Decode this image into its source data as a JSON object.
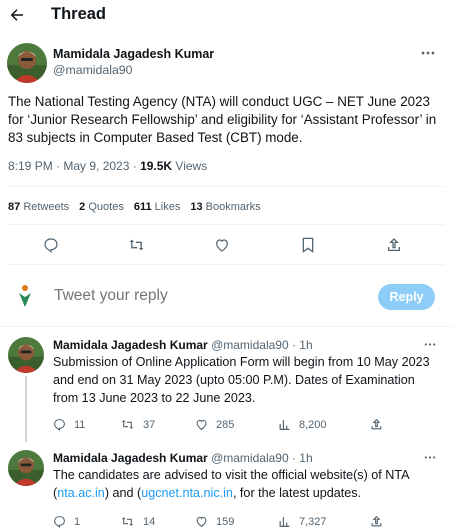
{
  "header": {
    "title": "Thread"
  },
  "main_tweet": {
    "author": "Mamidala Jagadesh Kumar",
    "handle": "@mamidala90",
    "text": "The National Testing Agency (NTA) will conduct UGC – NET June 2023 for ‘Junior Research Fellowship’ and eligibility for ‘Assistant Professor’ in 83 subjects in Computer Based Test (CBT) mode.",
    "time": "8:19 PM · May 9, 2023 · ",
    "views_count": "19.5K",
    "views_label": " Views",
    "retweets_count": "87",
    "retweets_label": "Retweets",
    "quotes_count": "2",
    "quotes_label": "Quotes",
    "likes_count": "611",
    "likes_label": "Likes",
    "bookmarks_count": "13",
    "bookmarks_label": "Bookmarks"
  },
  "reply_box": {
    "placeholder": "Tweet your reply",
    "button": "Reply"
  },
  "replies": [
    {
      "author": "Mamidala Jagadesh Kumar",
      "meta": "@mamidala90 · 1h",
      "text": "Submission of Online Application Form will begin from 10 May 2023 and end on 31 May 2023 (upto 05:00 P.M). Dates of Examination from 13 June 2023 to 22 June 2023.",
      "replies": "11",
      "retweets": "37",
      "likes": "285",
      "views": "8,200"
    },
    {
      "author": "Mamidala Jagadesh Kumar",
      "meta": "@mamidala90 · 1h",
      "text_a": "The candidates are advised to visit the official website(s) of NTA (",
      "link_1": "nta.ac.in",
      "text_b": ") and (",
      "link_2": "ugcnet.nta.nic.in",
      "text_c": ", for the latest updates.",
      "replies": "1",
      "retweets": "14",
      "likes": "159",
      "views": "7,327"
    }
  ],
  "icons": [
    "back-arrow-icon",
    "more-icon",
    "reply-icon",
    "retweet-icon",
    "like-icon",
    "bookmark-icon",
    "share-icon",
    "views-icon",
    "brand-logo-icon"
  ],
  "colors": {
    "accent": "#1d9bf0",
    "reply_button_disabled": "#8ecdf8",
    "muted": "#536471",
    "divider": "#eff3f4"
  }
}
